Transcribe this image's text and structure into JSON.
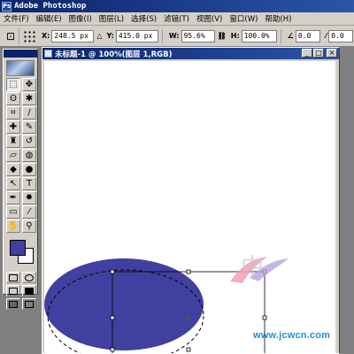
{
  "app": {
    "title": "Adobe Photoshop"
  },
  "menubar": {
    "items": [
      "文件(F)",
      "编辑(E)",
      "图像(I)",
      "图层(L)",
      "选择(S)",
      "滤镜(T)",
      "视图(V)",
      "窗口(W)",
      "帮助(H)"
    ]
  },
  "options": {
    "x_label": "X:",
    "x_value": "248.5 px",
    "y_label": "Y:",
    "y_value": "415.0 px",
    "w_label": "W:",
    "w_value": "95.6%",
    "h_label": "H:",
    "h_value": "100.0%",
    "angle_value": "0.0",
    "skew_value": "0.0"
  },
  "document": {
    "title": "未标题-1 @ 100%(图层 1,RGB)",
    "zoom_percent": 100,
    "window_buttons": [
      "_",
      "□",
      "×"
    ]
  },
  "colors": {
    "foreground": "#4040a0",
    "background": "#ffffff",
    "ellipse_fill": "#4040a0"
  },
  "toolbox": {
    "tools": [
      {
        "name": "marquee-tool",
        "glyph": "⬚"
      },
      {
        "name": "move-tool",
        "glyph": "✥"
      },
      {
        "name": "lasso-tool",
        "glyph": "ʘ"
      },
      {
        "name": "magic-wand-tool",
        "glyph": "✱"
      },
      {
        "name": "crop-tool",
        "glyph": "⌗"
      },
      {
        "name": "slice-tool",
        "glyph": "∕"
      },
      {
        "name": "healing-brush-tool",
        "glyph": "✚"
      },
      {
        "name": "brush-tool",
        "glyph": "✎"
      },
      {
        "name": "clone-stamp-tool",
        "glyph": "♜"
      },
      {
        "name": "history-brush-tool",
        "glyph": "↺"
      },
      {
        "name": "eraser-tool",
        "glyph": "▱"
      },
      {
        "name": "paint-bucket-tool",
        "glyph": "◍"
      },
      {
        "name": "blur-tool",
        "glyph": "◆"
      },
      {
        "name": "dodge-tool",
        "glyph": "●"
      },
      {
        "name": "path-selection-tool",
        "glyph": "↖"
      },
      {
        "name": "type-tool",
        "glyph": "T"
      },
      {
        "name": "pen-tool",
        "glyph": "✒"
      },
      {
        "name": "custom-shape-tool",
        "glyph": "✹"
      },
      {
        "name": "notes-tool",
        "glyph": "▭"
      },
      {
        "name": "eyedropper-tool",
        "glyph": "⁄"
      },
      {
        "name": "hand-tool",
        "glyph": "✋"
      },
      {
        "name": "zoom-tool",
        "glyph": "⚲"
      }
    ]
  },
  "watermark": {
    "text": "www.jcwcn.com",
    "logo_char": "中"
  }
}
